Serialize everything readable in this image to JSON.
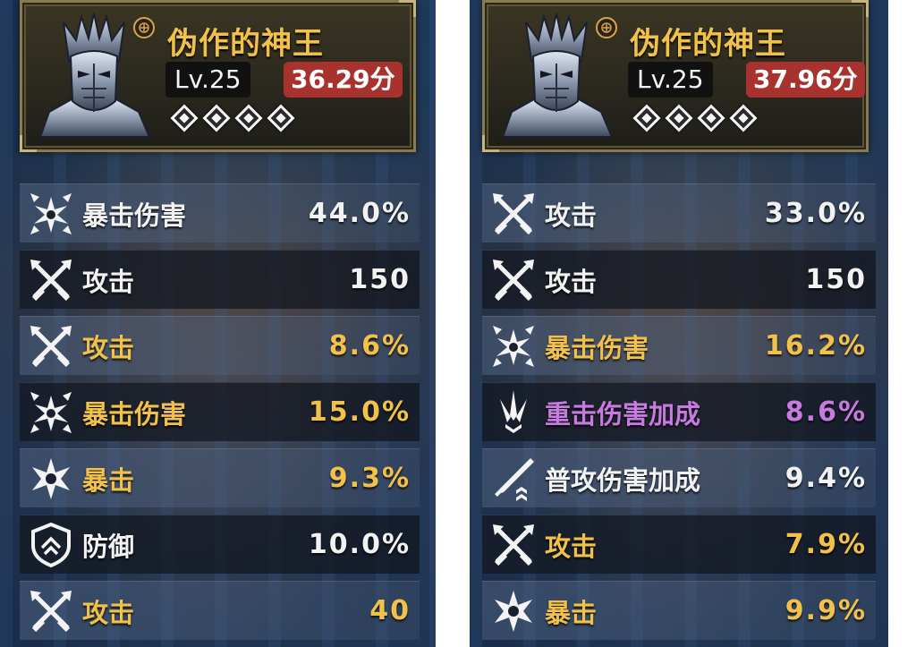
{
  "panels": [
    {
      "name": "伪作的神王",
      "level": "Lv.25",
      "score": "36.29分",
      "stats": [
        {
          "label": "暴击伤害",
          "value": "44.0%",
          "icon": "crit-damage-icon",
          "color": "white"
        },
        {
          "label": "攻击",
          "value": "150",
          "icon": "attack-icon",
          "color": "white"
        },
        {
          "label": "攻击",
          "value": "8.6%",
          "icon": "attack-icon",
          "color": "gold"
        },
        {
          "label": "暴击伤害",
          "value": "15.0%",
          "icon": "crit-damage-icon",
          "color": "gold"
        },
        {
          "label": "暴击",
          "value": "9.3%",
          "icon": "crit-icon",
          "color": "gold"
        },
        {
          "label": "防御",
          "value": "10.0%",
          "icon": "defense-icon",
          "color": "white"
        },
        {
          "label": "攻击",
          "value": "40",
          "icon": "attack-icon",
          "color": "gold"
        }
      ]
    },
    {
      "name": "伪作的神王",
      "level": "Lv.25",
      "score": "37.96分",
      "stats": [
        {
          "label": "攻击",
          "value": "33.0%",
          "icon": "attack-icon",
          "color": "white"
        },
        {
          "label": "攻击",
          "value": "150",
          "icon": "attack-icon",
          "color": "white"
        },
        {
          "label": "暴击伤害",
          "value": "16.2%",
          "icon": "crit-damage-icon",
          "color": "gold"
        },
        {
          "label": "重击伤害加成",
          "value": "8.6%",
          "icon": "heavy-attack-icon",
          "color": "purple"
        },
        {
          "label": "普攻伤害加成",
          "value": "9.4%",
          "icon": "basic-attack-icon",
          "color": "white"
        },
        {
          "label": "攻击",
          "value": "7.9%",
          "icon": "attack-icon",
          "color": "gold"
        },
        {
          "label": "暴击",
          "value": "9.9%",
          "icon": "crit-icon",
          "color": "gold"
        }
      ]
    }
  ],
  "colors": {
    "white": "#f2f2f2",
    "gold": "#f2c14a",
    "purple": "#c77be0",
    "score_bg": "#a8332e",
    "frame": "#8b7a4e"
  }
}
